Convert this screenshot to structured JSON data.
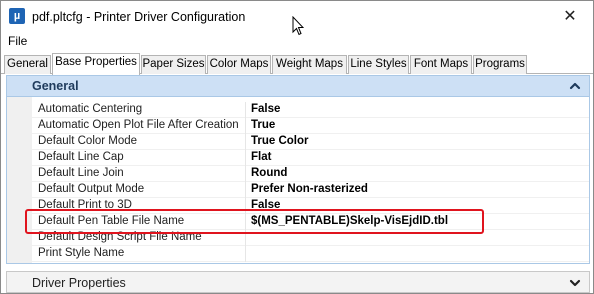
{
  "window": {
    "title": "pdf.pltcfg - Printer Driver Configuration",
    "close_glyph": "✕",
    "icon_letter": "µ"
  },
  "menu": {
    "items": [
      "File"
    ]
  },
  "tabs": [
    {
      "label": "General",
      "active": false
    },
    {
      "label": "Base Properties",
      "active": true
    },
    {
      "label": "Paper Sizes",
      "active": false
    },
    {
      "label": "Color Maps",
      "active": false
    },
    {
      "label": "Weight Maps",
      "active": false
    },
    {
      "label": "Line Styles",
      "active": false
    },
    {
      "label": "Font Maps",
      "active": false
    },
    {
      "label": "Programs",
      "active": false
    }
  ],
  "general_section": {
    "title": "General",
    "expanded": true,
    "properties": [
      {
        "name": "Automatic Centering",
        "value": "False"
      },
      {
        "name": "Automatic Open Plot File After Creation",
        "value": "True"
      },
      {
        "name": "Default Color Mode",
        "value": "True Color"
      },
      {
        "name": "Default Line Cap",
        "value": "Flat"
      },
      {
        "name": "Default Line Join",
        "value": "Round"
      },
      {
        "name": "Default Output Mode",
        "value": "Prefer Non-rasterized"
      },
      {
        "name": "Default Print to 3D",
        "value": "False"
      },
      {
        "name": "Default Pen Table File Name",
        "value": "$(MS_PENTABLE)Skelp-VisEjdID.tbl"
      },
      {
        "name": "Default Design Script File Name",
        "value": ""
      },
      {
        "name": "Print Style Name",
        "value": ""
      }
    ]
  },
  "driver_section": {
    "title": "Driver Properties",
    "expanded": false
  },
  "colors": {
    "section_header_bg": "#cde0f5",
    "highlight": "#e0141e",
    "app_icon": "#1e64b4"
  }
}
